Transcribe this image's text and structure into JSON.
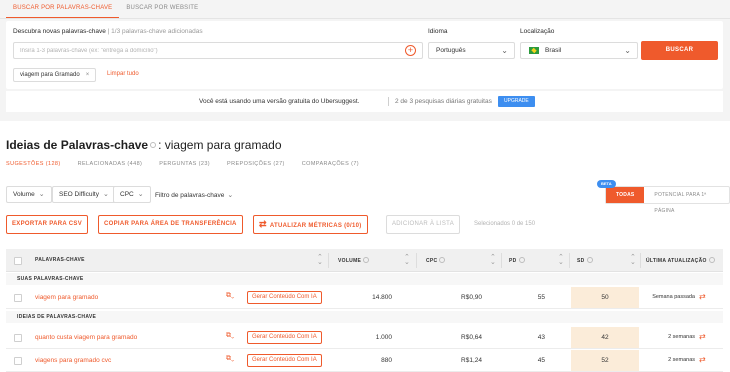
{
  "tabs": [
    {
      "label": "BUSCAR POR PALAVRAS-CHAVE",
      "active": true
    },
    {
      "label": "BUSCAR POR WEBSITE",
      "active": false
    }
  ],
  "search": {
    "label": "Descubra novas palavras-chave",
    "counter": "1/3 palavras-chave adicionadas",
    "placeholder": "Insira 1-3 palavras-chave (ex: \"entrega a domicílio\")",
    "language_label": "Idioma",
    "language_value": "Português",
    "location_label": "Localização",
    "location_value": "Brasil",
    "submit": "BUSCAR",
    "chip": "viagem para Gramado",
    "clear": "Limpar tudo"
  },
  "banner": {
    "text": "Você está usando uma versão gratuita do Ubersuggest.",
    "quota": "2 de 3 pesquisas diárias gratuitas",
    "upgrade": "UPGRADE"
  },
  "ideas": {
    "title": "Ideias de Palavras-chave",
    "query": ": viagem para gramado",
    "subtabs": [
      {
        "label": "SUGESTÕES (128)",
        "active": true
      },
      {
        "label": "RELACIONADAS (448)",
        "active": false
      },
      {
        "label": "PERGUNTAS (23)",
        "active": false
      },
      {
        "label": "PREPOSIÇÕES (27)",
        "active": false
      },
      {
        "label": "COMPARAÇÕES (7)",
        "active": false
      }
    ]
  },
  "filters": {
    "volume": "Volume",
    "seo_difficulty": "SEO Difficulty",
    "cpc": "CPC",
    "keyword_filter": "Filtro de palavras-chave",
    "toggle_all": "TODAS",
    "toggle_potential": "POTENCIAL PARA 1ª PÁGINA",
    "beta": "BETA"
  },
  "actions": {
    "export": "EXPORTAR PARA CSV",
    "copy": "COPIAR PARA ÁREA DE TRANSFERÊNCIA",
    "update": "ATUALIZAR MÉTRICAS (0/10)",
    "add_list": "ADICIONAR À LISTA",
    "selected": "Selecionados 0 de 150"
  },
  "table": {
    "headers": {
      "keyword": "PALAVRAS-CHAVE",
      "volume": "VOLUME",
      "cpc": "CPC",
      "pd": "PD",
      "sd": "SD",
      "updated": "ÚLTIMA ATUALIZAÇÃO"
    },
    "section_own": "SUAS PALAVRAS-CHAVE",
    "section_ideas": "IDEIAS DE PALAVRAS-CHAVE",
    "ai_button": "Gerar Conteúdo Com IA",
    "rows": [
      {
        "keyword": "viagem para gramado",
        "volume": "14.800",
        "cpc": "R$0,90",
        "pd": "55",
        "sd": "50",
        "updated": "Semana passada"
      },
      {
        "keyword": "quanto custa viagem para gramado",
        "volume": "1.000",
        "cpc": "R$0,64",
        "pd": "43",
        "sd": "42",
        "updated": "2 semanas"
      },
      {
        "keyword": "viagens para gramado cvc",
        "volume": "880",
        "cpc": "R$1,24",
        "pd": "45",
        "sd": "52",
        "updated": "2 semanas"
      }
    ]
  },
  "colors": {
    "accent": "#ef5a2c",
    "upgrade_blue": "#3d8ef0",
    "sd_cell": "#fbecd9"
  },
  "icons": {
    "plus": "plus-circle-icon",
    "chevron": "chevron-down-icon",
    "refresh": "refresh-icon",
    "ai": "ai-content-icon",
    "info": "info-icon",
    "sort": "sort-arrows-icon"
  }
}
